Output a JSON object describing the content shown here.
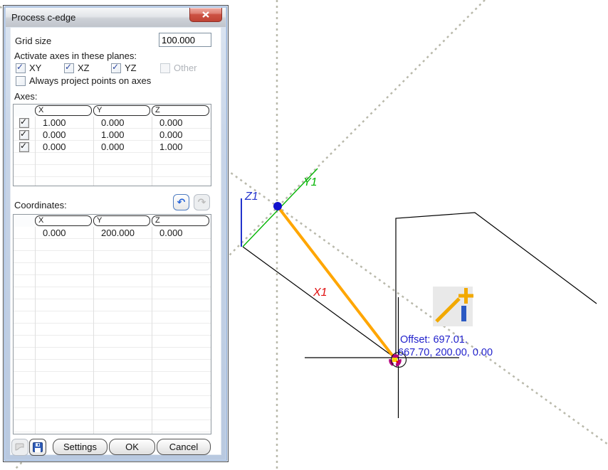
{
  "window": {
    "title": "Process c-edge"
  },
  "form": {
    "grid_size_label": "Grid size",
    "grid_size_value": "100.000",
    "activate_label": "Activate axes in these planes:",
    "plane_checkboxes": [
      {
        "label": "XY",
        "checked": true
      },
      {
        "label": "XZ",
        "checked": true
      },
      {
        "label": "YZ",
        "checked": true
      },
      {
        "label": "Other",
        "checked": false,
        "disabled": true
      }
    ],
    "always_project": {
      "label": "Always project points on axes",
      "checked": false
    }
  },
  "axes_section": {
    "label": "Axes:",
    "columns": [
      "X",
      "Y",
      "Z"
    ],
    "rows": [
      {
        "checked": true,
        "values": [
          "1.000",
          "0.000",
          "0.000"
        ]
      },
      {
        "checked": true,
        "values": [
          "0.000",
          "1.000",
          "0.000"
        ]
      },
      {
        "checked": true,
        "values": [
          "0.000",
          "0.000",
          "1.000"
        ]
      }
    ]
  },
  "coordinates_section": {
    "label": "Coordinates:",
    "columns": [
      "X",
      "Y",
      "Z"
    ],
    "rows": [
      {
        "values": [
          "0.000",
          "200.000",
          "0.000"
        ]
      }
    ]
  },
  "buttons": {
    "settings": "Settings",
    "ok": "OK",
    "cancel": "Cancel"
  },
  "canvas": {
    "axis_labels": {
      "x": "X1",
      "y": "Y1",
      "z": "Z1"
    },
    "offset_line1": "Offset: 697.01.",
    "offset_line2": "667.70, 200.00, 0.00",
    "colors": {
      "construction_dash": "#b9b9ab",
      "axis_x_label": "#e01010",
      "axis_y": "#00b400",
      "axis_z": "#2233cc",
      "rubber_line": "#ffa600",
      "point": "#1111cc",
      "offset_text": "#2222cc",
      "snap_marker": "#b4007e",
      "snap_center": "#ffd400",
      "geometry": "#000000"
    }
  }
}
